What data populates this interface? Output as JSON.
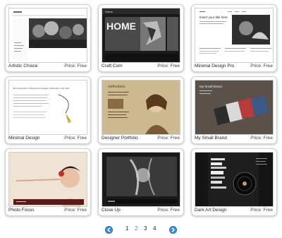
{
  "items": [
    {
      "name": "Artistic Choice",
      "price": "Price: Free"
    },
    {
      "name": "Craft Com",
      "price": "Price: Free"
    },
    {
      "name": "Minimal Design Pro",
      "price": "Price: Free"
    },
    {
      "name": "Minimal Design",
      "price": "Price: Free"
    },
    {
      "name": "Designer Portfolio",
      "price": "Price: Free"
    },
    {
      "name": "My Small Brand",
      "price": "Price: Free"
    },
    {
      "name": "Photo Focus",
      "price": "Price: Free"
    },
    {
      "name": "Close Up",
      "price": "Price: Free"
    },
    {
      "name": "Dark Art Design",
      "price": "Price: Free"
    }
  ],
  "thumbs": {
    "t2_nav": "Home",
    "t2_logo": "HOME",
    "t3_heading": "Insert your title here",
    "t4_heading": "Hi everybody! I am jewelry designer. Welcome to my site!",
    "t5_heading": "ArtPortfolio",
    "t6_heading": "My Small Brand"
  },
  "pagination": {
    "pages": [
      "1",
      "2",
      "3",
      "4"
    ],
    "current_page": "2",
    "prev_icon": "arrow-left-icon",
    "next_icon": "arrow-right-icon",
    "accent": "#3f8fd6"
  }
}
